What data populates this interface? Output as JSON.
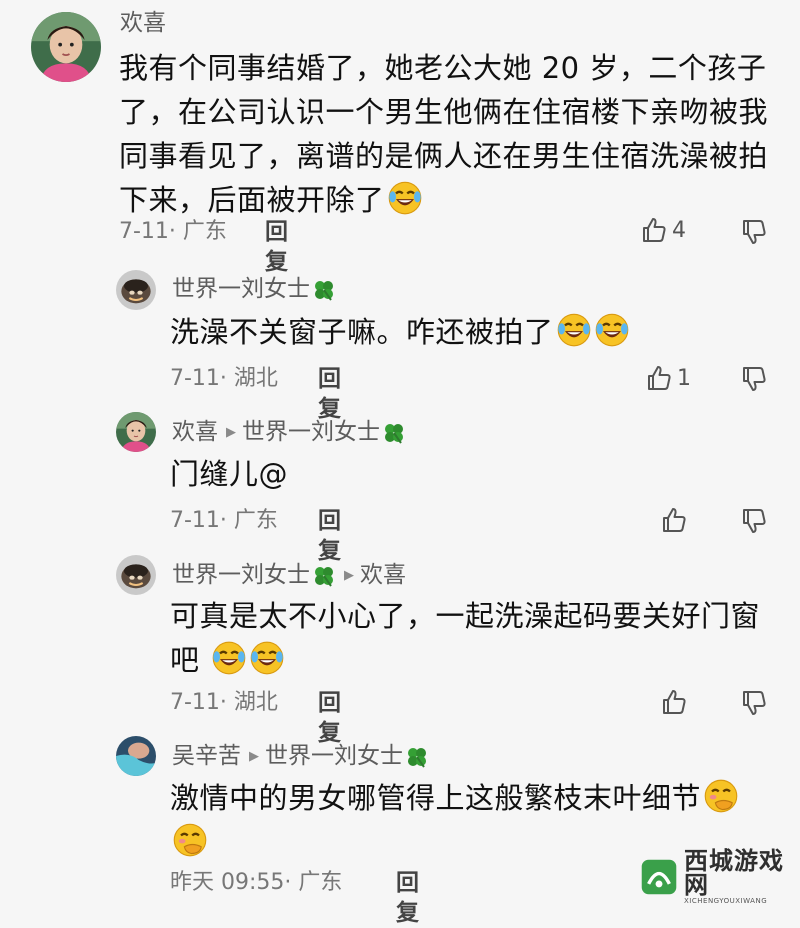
{
  "comments": [
    {
      "user": "欢喜",
      "lines": [
        "我有个同事结婚了，她老公大她 20 岁，二个孩子",
        "了，在公司认识一个男生他俩在住宿楼下亲吻被我",
        "同事看见了，离谱的是俩人还在男生住宿洗澡被拍",
        "下来，后面被开除了"
      ],
      "meta": "7-11· 广东",
      "reply": "回复",
      "likes": "4"
    },
    {
      "user": "世界一刘女士",
      "lines": [
        "洗澡不关窗子嘛。咋还被拍了"
      ],
      "meta": "7-11· 湖北",
      "reply": "回复",
      "likes": "1"
    },
    {
      "user": "欢喜",
      "reply_to": "世界一刘女士",
      "lines": [
        "门缝儿@"
      ],
      "meta": "7-11· 广东",
      "reply": "回复",
      "likes": ""
    },
    {
      "user": "世界一刘女士",
      "reply_to": "欢喜",
      "lines": [
        "可真是太不小心了，一起洗澡起码要关好门窗",
        "吧"
      ],
      "meta": "7-11· 湖北",
      "reply": "回复",
      "likes": ""
    },
    {
      "user": "吴辛苦",
      "reply_to": "世界一刘女士",
      "lines": [
        "激情中的男女哪管得上这般繁枝末叶细节"
      ],
      "meta": "昨天 09:55· 广东",
      "reply": "回复"
    }
  ],
  "watermark": {
    "title": "西城游戏网",
    "sub": "XICHENGYOUXIWANG"
  },
  "icons": {
    "emoji_laugh_cry": "face-with-tears-of-joy",
    "emoji_giggle": "face-with-hand-over-mouth",
    "badge": "four-leaf-clover"
  },
  "colors": {
    "name": "#5d5d5d",
    "meta": "#777777",
    "clover": "#2e8b2e",
    "emoji": "#f5b820"
  }
}
